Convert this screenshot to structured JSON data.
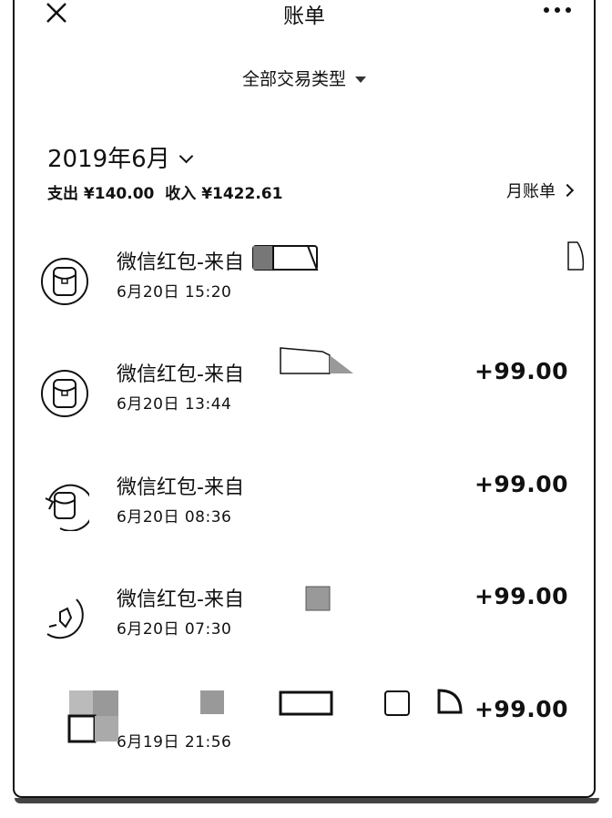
{
  "header": {
    "title": "账单"
  },
  "filter": {
    "label": "全部交易类型"
  },
  "month": {
    "label": "2019年6月",
    "summary_expense": "支出 ¥140.00",
    "summary_income": "收入 ¥1422.61",
    "monthly_bill_label": "月账单"
  },
  "transactions": [
    {
      "title": "微信红包-来自",
      "time": "6月20日 15:20",
      "amount": ""
    },
    {
      "title": "微信红包-来自",
      "time": "6月20日 13:44",
      "amount": "+99.00"
    },
    {
      "title": "微信红包-来自",
      "time": "6月20日 08:36",
      "amount": "+99.00"
    },
    {
      "title": "微信红包-来自",
      "time": "6月20日 07:30",
      "amount": "+99.00"
    },
    {
      "title": "",
      "time": "6月19日 21:56",
      "amount": "+99.00"
    }
  ],
  "icons": {
    "close": "close-icon",
    "more": "more-icon",
    "dropdown": "triangle-down-icon",
    "chevron_down": "chevron-down-icon",
    "chevron_right": "chevron-right-icon",
    "red_packet": "red-packet-icon"
  }
}
